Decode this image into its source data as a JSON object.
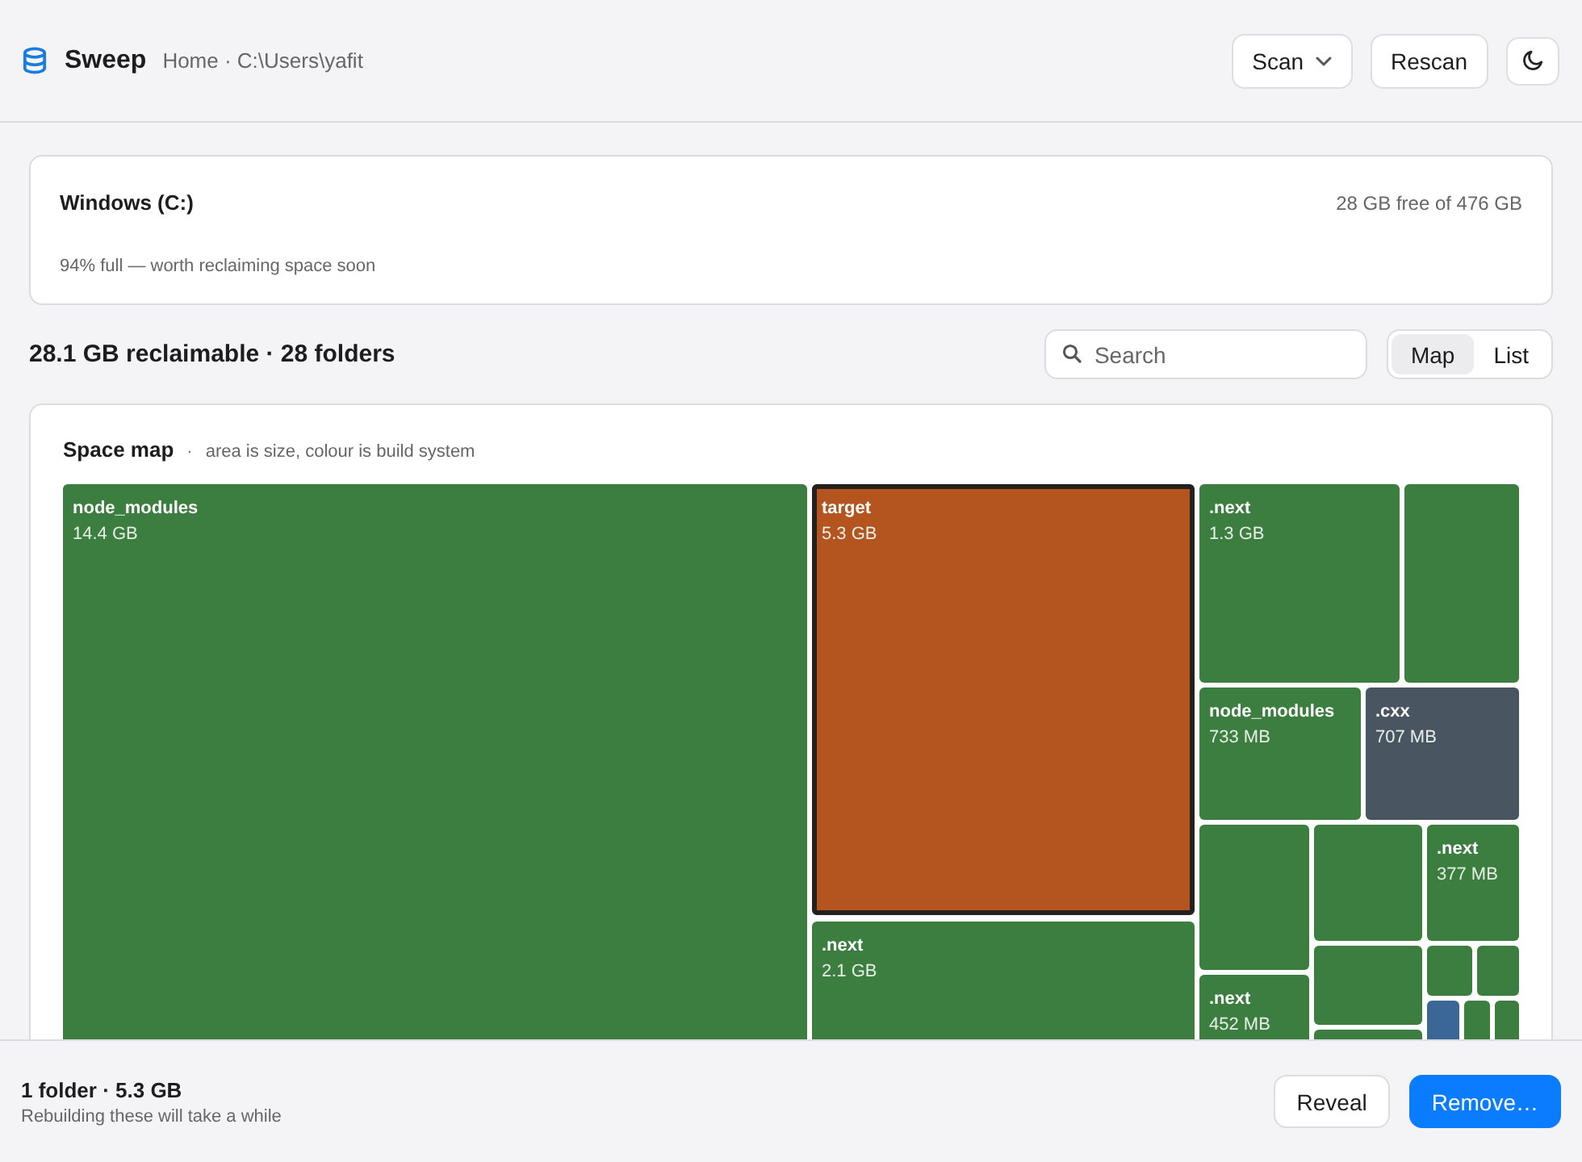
{
  "header": {
    "app_name": "Sweep",
    "breadcrumb": "Home · C:\\Users\\yafit",
    "scan_button": "Scan",
    "rescan_button": "Rescan"
  },
  "drive": {
    "name": "Windows (C:)",
    "free": "28 GB free of 476 GB",
    "note": "94% full — worth reclaiming space soon"
  },
  "summary": "28.1 GB reclaimable · 28 folders",
  "search": {
    "placeholder": "Search"
  },
  "view_toggle": [
    {
      "label": "Map",
      "selected": true
    },
    {
      "label": "List",
      "selected": false
    }
  ],
  "map": {
    "title": "Space map",
    "separator": "·",
    "caption": "area is size, colour is build system",
    "tiles": [
      {
        "name": "node_modules",
        "size": "14.4 GB",
        "color": "#3c7d40",
        "selected": false
      },
      {
        "name": "target",
        "size": "5.3 GB",
        "color": "#b4541f",
        "selected": true
      },
      {
        "name": ".next",
        "size": "2.1 GB",
        "color": "#3c7d40",
        "selected": false
      },
      {
        "name": ".next",
        "size": "1.3 GB",
        "color": "#3c7d40",
        "selected": false
      },
      {
        "color": "#3c7d40",
        "selected": false
      },
      {
        "name": "node_modules",
        "size": "733 MB",
        "color": "#3c7d40",
        "selected": false
      },
      {
        "name": ".cxx",
        "size": "707 MB",
        "color": "#4a5562",
        "selected": false
      },
      {
        "color": "#3c7d40",
        "selected": false
      },
      {
        "name": ".next",
        "size": "452 MB",
        "color": "#3c7d40",
        "selected": false
      },
      {
        "color": "#3c7d40",
        "selected": false
      },
      {
        "name": ".next",
        "size": "377 MB",
        "color": "#3c7d40",
        "selected": false
      },
      {
        "color": "#3c7d40",
        "selected": false
      },
      {
        "color": "#3c7d40",
        "selected": false
      },
      {
        "color": "#3c7d40",
        "selected": false
      },
      {
        "color": "#3c7d40",
        "selected": false
      },
      {
        "color": "#3b6797",
        "selected": false
      },
      {
        "color": "#3c7d40",
        "selected": false
      },
      {
        "color": "#3c7d40",
        "selected": false
      }
    ]
  },
  "footer": {
    "selection": "1 folder · 5.3 GB",
    "hint": "Rebuilding these will take a while",
    "buttons": [
      {
        "label": "Reveal",
        "kind": "secondary"
      },
      {
        "label": "Remove…",
        "kind": "primary"
      }
    ]
  }
}
